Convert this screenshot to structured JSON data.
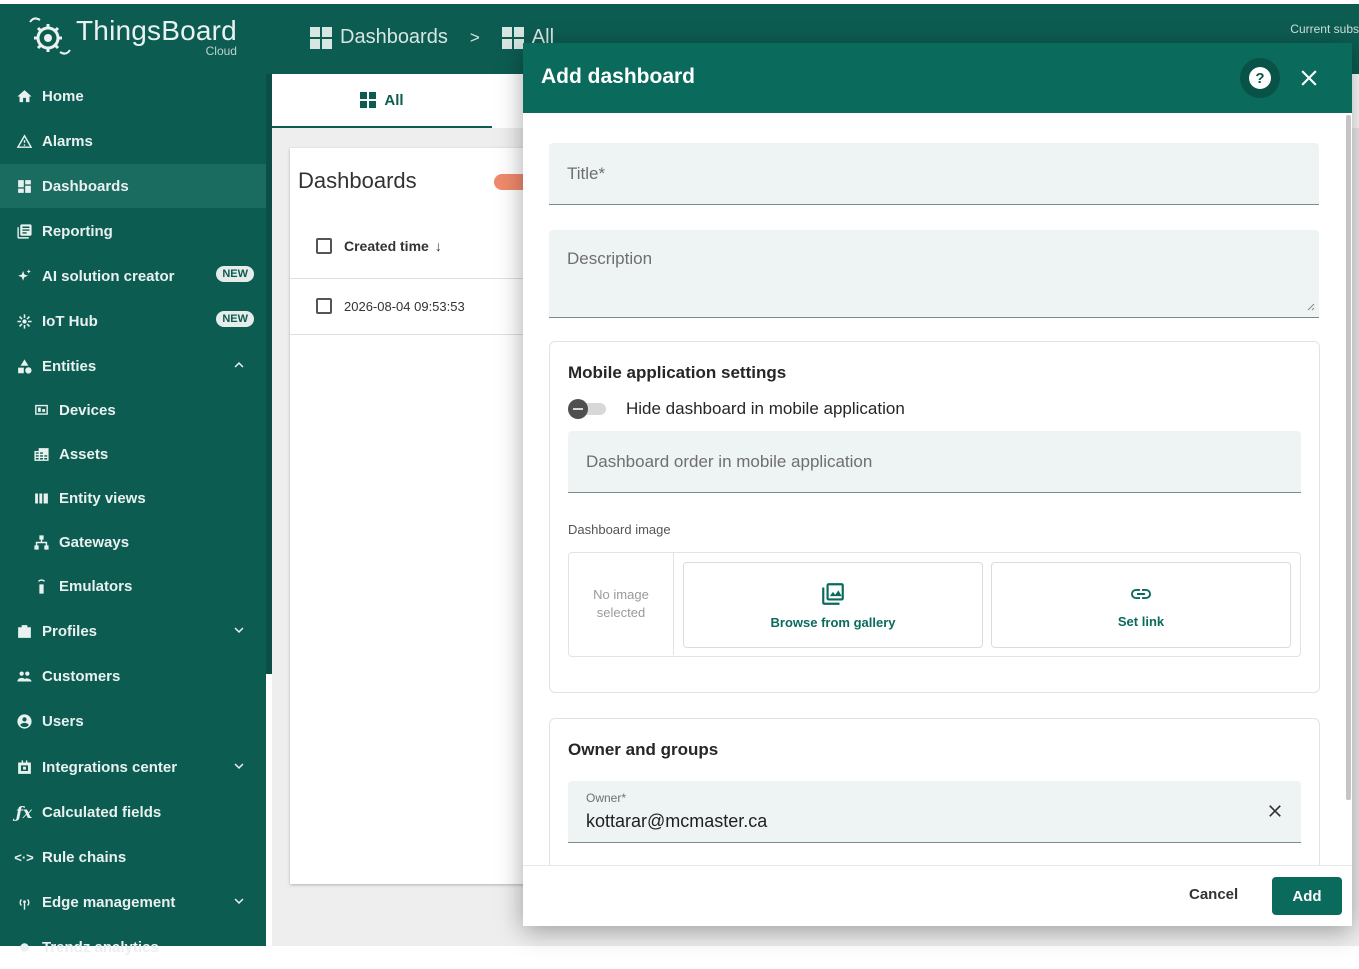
{
  "app": {
    "name": "ThingsBoard",
    "subtitle": "Cloud",
    "current_subscription": "Current subs"
  },
  "breadcrumb": {
    "items": [
      "Dashboards",
      "All"
    ],
    "separator": ">"
  },
  "sidebar": {
    "items": [
      {
        "label": "Home",
        "icon": "home-icon"
      },
      {
        "label": "Alarms",
        "icon": "alarm-warning-icon"
      },
      {
        "label": "Dashboards",
        "icon": "dashboard-icon",
        "active": true
      },
      {
        "label": "Reporting",
        "icon": "reporting-icon"
      },
      {
        "label": "AI solution creator",
        "icon": "sparkle-icon",
        "badge": "NEW"
      },
      {
        "label": "IoT Hub",
        "icon": "hub-icon",
        "badge": "NEW"
      },
      {
        "label": "Entities",
        "icon": "entities-icon",
        "expanded": true
      },
      {
        "label": "Devices",
        "icon": "devices-icon"
      },
      {
        "label": "Assets",
        "icon": "assets-icon"
      },
      {
        "label": "Entity views",
        "icon": "entity-views-icon"
      },
      {
        "label": "Gateways",
        "icon": "gateways-icon"
      },
      {
        "label": "Emulators",
        "icon": "emulators-icon"
      },
      {
        "label": "Profiles",
        "icon": "profiles-icon"
      },
      {
        "label": "Customers",
        "icon": "customers-icon"
      },
      {
        "label": "Users",
        "icon": "users-icon"
      },
      {
        "label": "Integrations center",
        "icon": "integrations-icon"
      },
      {
        "label": "Calculated fields",
        "icon": "function-icon"
      },
      {
        "label": "Rule chains",
        "icon": "rule-chains-icon"
      },
      {
        "label": "Edge management",
        "icon": "edge-icon"
      },
      {
        "label": "Trendz analytics",
        "icon": "trendz-icon"
      }
    ]
  },
  "main": {
    "tab_label": "All",
    "card_title": "Dashboards",
    "column_header": "Created time",
    "rows": [
      "2026-08-04 09:53:53"
    ]
  },
  "dialog": {
    "title": "Add dashboard",
    "title_placeholder": "Title*",
    "description_placeholder": "Description",
    "mobile_section_title": "Mobile application settings",
    "hide_toggle_label": "Hide dashboard in mobile application",
    "order_placeholder": "Dashboard order in mobile application",
    "image_label": "Dashboard image",
    "no_image_text": "No image selected",
    "browse_button": "Browse from gallery",
    "set_link_button": "Set link",
    "owner_section_title": "Owner and groups",
    "owner_label": "Owner*",
    "owner_value": "kottarar@mcmaster.ca",
    "cancel_button": "Cancel",
    "add_button": "Add"
  },
  "colors": {
    "brand_primary": "#0d5c52",
    "dialog_header": "#0a6b5c",
    "field_background": "#eef4f3"
  }
}
